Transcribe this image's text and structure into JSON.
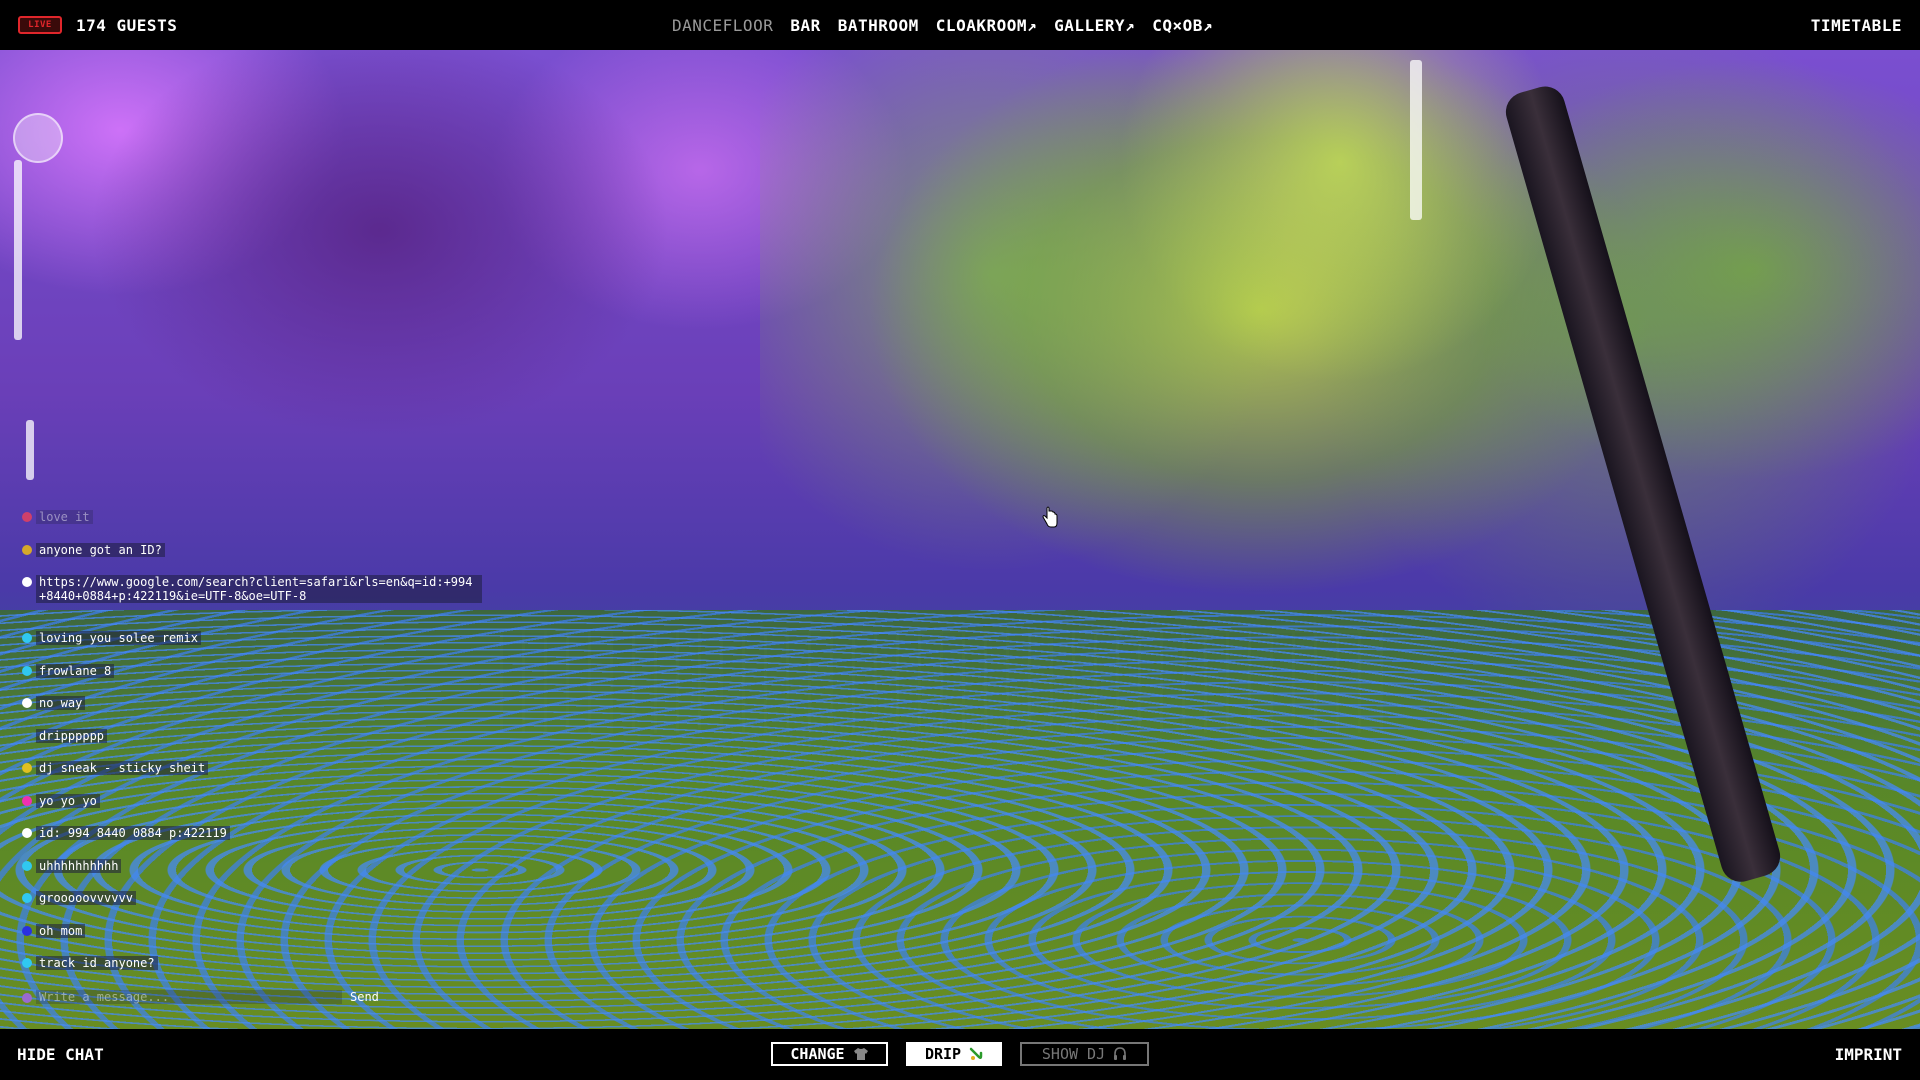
{
  "header": {
    "live_badge": "LIVE",
    "guests": "174 GUESTS",
    "nav": [
      "DANCEFLOOR",
      "BAR",
      "BATHROOM",
      "CLOAKROOM↗",
      "GALLERY↗",
      "CQ×OB↗"
    ],
    "active_nav": "DANCEFLOOR",
    "timetable": "TIMETABLE"
  },
  "chat": {
    "messages": [
      {
        "text": "love it",
        "color": "#d0406a",
        "faded": true
      },
      {
        "text": "anyone got an ID?",
        "color": "#d6a82a"
      },
      {
        "text": "https://www.google.com/search?client=safari&rls=en&q=id:+994+8440+0884+p:422119&ie=UTF-8&oe=UTF-8",
        "color": "#ffffff"
      },
      {
        "text": "loving you solee remix",
        "color": "#30c8f0"
      },
      {
        "text": "frowlane 8",
        "color": "#30c8f0"
      },
      {
        "text": "no way",
        "color": "#ffffff"
      },
      {
        "text": "dripppppp",
        "color": ""
      },
      {
        "text": "dj sneak - sticky sheit",
        "color": "#e0c020"
      },
      {
        "text": "yo yo yo",
        "color": "#f030b0"
      },
      {
        "text": "id: 994 8440 0884 p:422119",
        "color": "#ffffff"
      },
      {
        "text": "uhhhhhhhhhh",
        "color": "#30c8f0"
      },
      {
        "text": "grooooovvvvvv",
        "color": "#30c8f0"
      },
      {
        "text": "oh mom",
        "color": "#2a30e0"
      },
      {
        "text": "track id anyone?",
        "color": "#30c8f0"
      }
    ],
    "input_placeholder": "Write a message...",
    "send_label": "Send",
    "input_dot_color": "#9a6ad0"
  },
  "footer": {
    "hide_chat": "HIDE CHAT",
    "change_label": "CHANGE",
    "drip_label": "DRIP",
    "show_dj_label": "SHOW DJ",
    "imprint": "IMPRINT"
  },
  "icons": {
    "change": "shirt-icon",
    "drip": "drip-icon",
    "show_dj": "headphones-icon"
  }
}
